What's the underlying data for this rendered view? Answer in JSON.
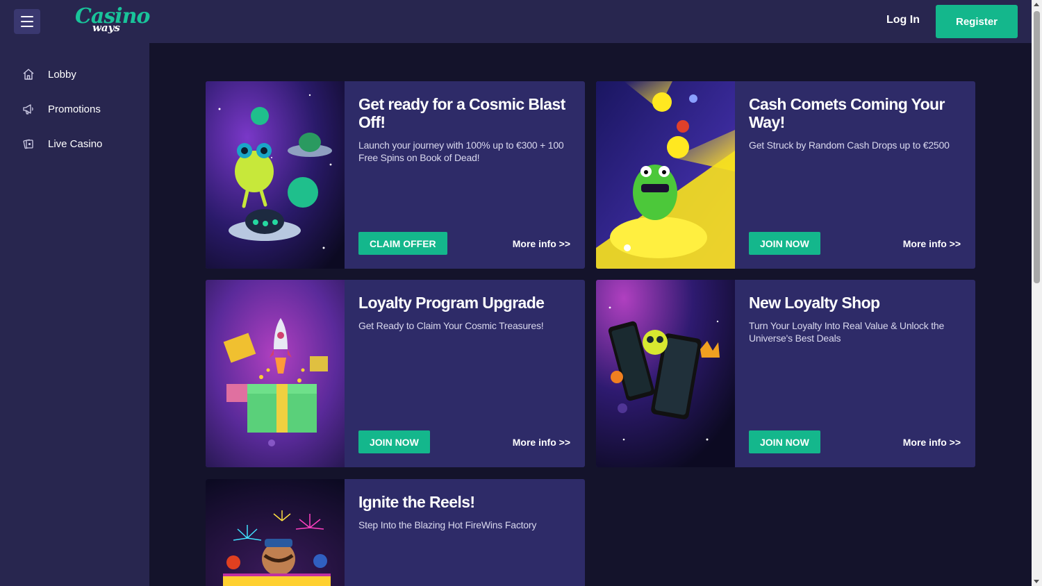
{
  "header": {
    "logo_main": "Casino",
    "logo_sub": "ways",
    "login_label": "Log In",
    "register_label": "Register"
  },
  "sidebar": {
    "items": [
      {
        "label": "Lobby",
        "icon": "home-icon"
      },
      {
        "label": "Promotions",
        "icon": "megaphone-icon"
      },
      {
        "label": "Live Casino",
        "icon": "cards-icon"
      }
    ]
  },
  "promotions": [
    {
      "title": "Get ready for a Cosmic Blast Off!",
      "description": "Launch your journey with 100% up to €300 + 100 Free Spins on Book of Dead!",
      "cta": "CLAIM OFFER",
      "more": "More info >>"
    },
    {
      "title": "Cash Comets Coming Your Way!",
      "description": "Get Struck by Random Cash Drops up to €2500",
      "cta": "JOIN NOW",
      "more": "More info >>"
    },
    {
      "title": "Loyalty Program Upgrade",
      "description": "Get Ready to Claim Your Cosmic Treasures!",
      "cta": "JOIN NOW",
      "more": "More info >>"
    },
    {
      "title": "New Loyalty Shop",
      "description": "Turn Your Loyalty Into Real Value & Unlock the Universe's Best Deals",
      "cta": "JOIN NOW",
      "more": "More info >>"
    },
    {
      "title": "Ignite the Reels!",
      "description": "Step Into the Blazing Hot FireWins Factory"
    }
  ],
  "colors": {
    "accent": "#14b78c",
    "panel": "#28264f",
    "card": "#2e2b68",
    "background": "#14132b"
  }
}
